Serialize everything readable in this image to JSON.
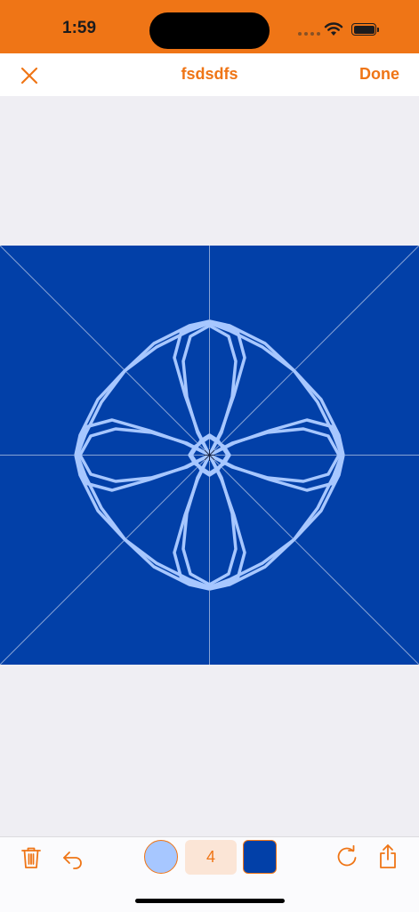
{
  "status": {
    "time": "1:59"
  },
  "nav": {
    "title": "fsdsdfs",
    "done_label": "Done"
  },
  "toolbar": {
    "symmetry_count": "4"
  },
  "colors": {
    "brand": "#ef7516",
    "stroke_color": "#a7c7ff",
    "canvas_background": "#0240a8",
    "guide_lines": "#9fb4dd"
  },
  "icons": {
    "close": "close-icon",
    "delete": "trash-icon",
    "undo": "undo-icon",
    "redo": "redo-icon",
    "share": "share-icon"
  }
}
